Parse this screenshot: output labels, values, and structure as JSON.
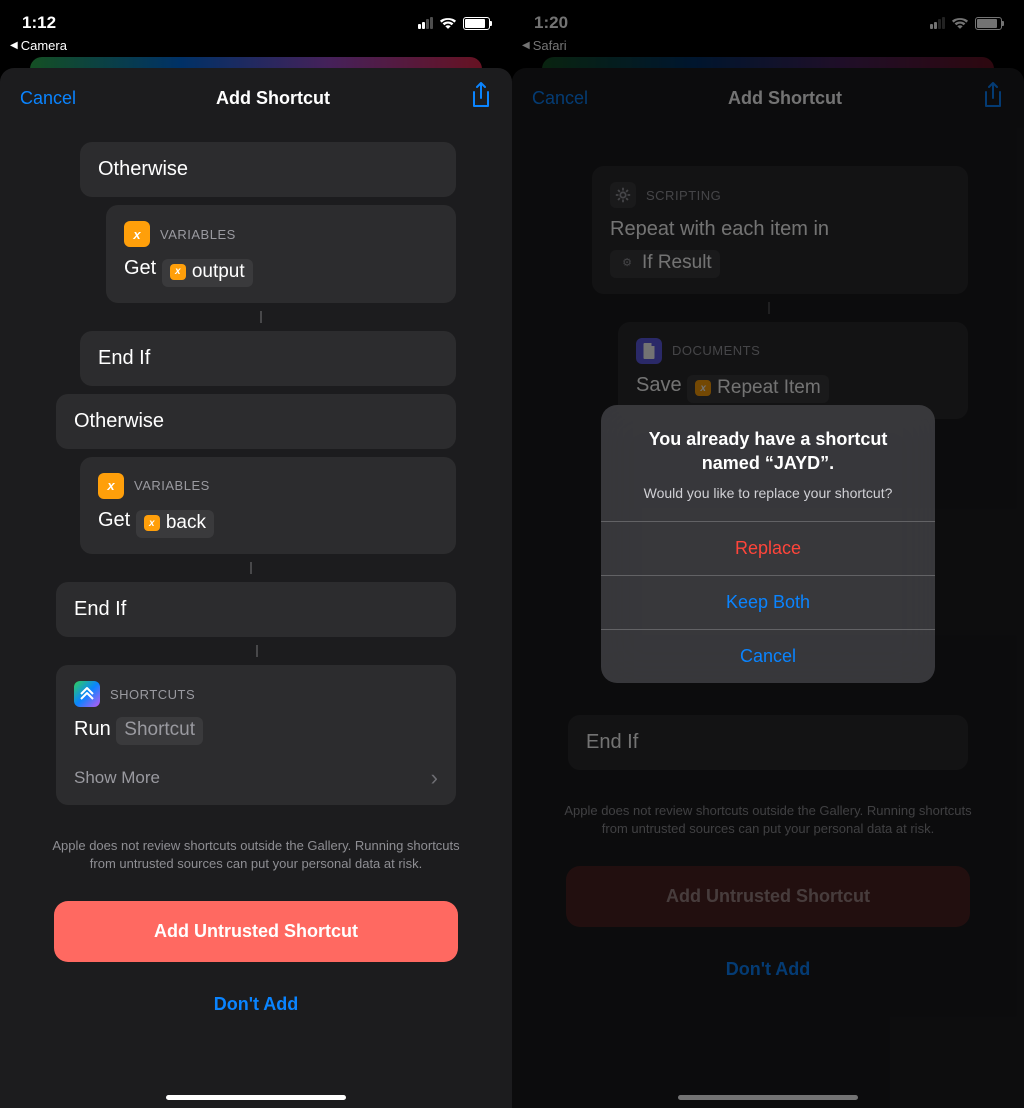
{
  "left": {
    "status": {
      "time": "1:12",
      "breadcrumb": "Camera"
    },
    "nav": {
      "cancel": "Cancel",
      "title": "Add Shortcut"
    },
    "blocks": {
      "otherwise1": "Otherwise",
      "vars1": {
        "caption": "VARIABLES",
        "get": "Get",
        "token": "output"
      },
      "endif1": "End If",
      "otherwise2": "Otherwise",
      "vars2": {
        "caption": "VARIABLES",
        "get": "Get",
        "token": "back"
      },
      "endif2": "End If",
      "shortcuts": {
        "caption": "SHORTCUTS",
        "run": "Run",
        "token": "Shortcut",
        "showMore": "Show More"
      }
    },
    "disclaimer": "Apple does not review shortcuts outside the Gallery. Running shortcuts from untrusted sources can put your personal data at risk.",
    "primary": "Add Untrusted Shortcut",
    "secondary": "Don't Add"
  },
  "right": {
    "status": {
      "time": "1:20",
      "breadcrumb": "Safari"
    },
    "nav": {
      "cancel": "Cancel",
      "title": "Add Shortcut"
    },
    "blocks": {
      "scripting": {
        "caption": "SCRIPTING",
        "line": "Repeat with each item in",
        "token": "If Result"
      },
      "documents": {
        "caption": "DOCUMENTS",
        "save": "Save",
        "token": "Repeat Item"
      },
      "endif": "End If"
    },
    "alert": {
      "title": "You already have a shortcut named “JAYD”.",
      "message": "Would you like to replace your shortcut?",
      "replace": "Replace",
      "keepBoth": "Keep Both",
      "cancel": "Cancel"
    },
    "disclaimer": "Apple does not review shortcuts outside the Gallery. Running shortcuts from untrusted sources can put your personal data at risk.",
    "primary": "Add Untrusted Shortcut",
    "secondary": "Don't Add"
  }
}
